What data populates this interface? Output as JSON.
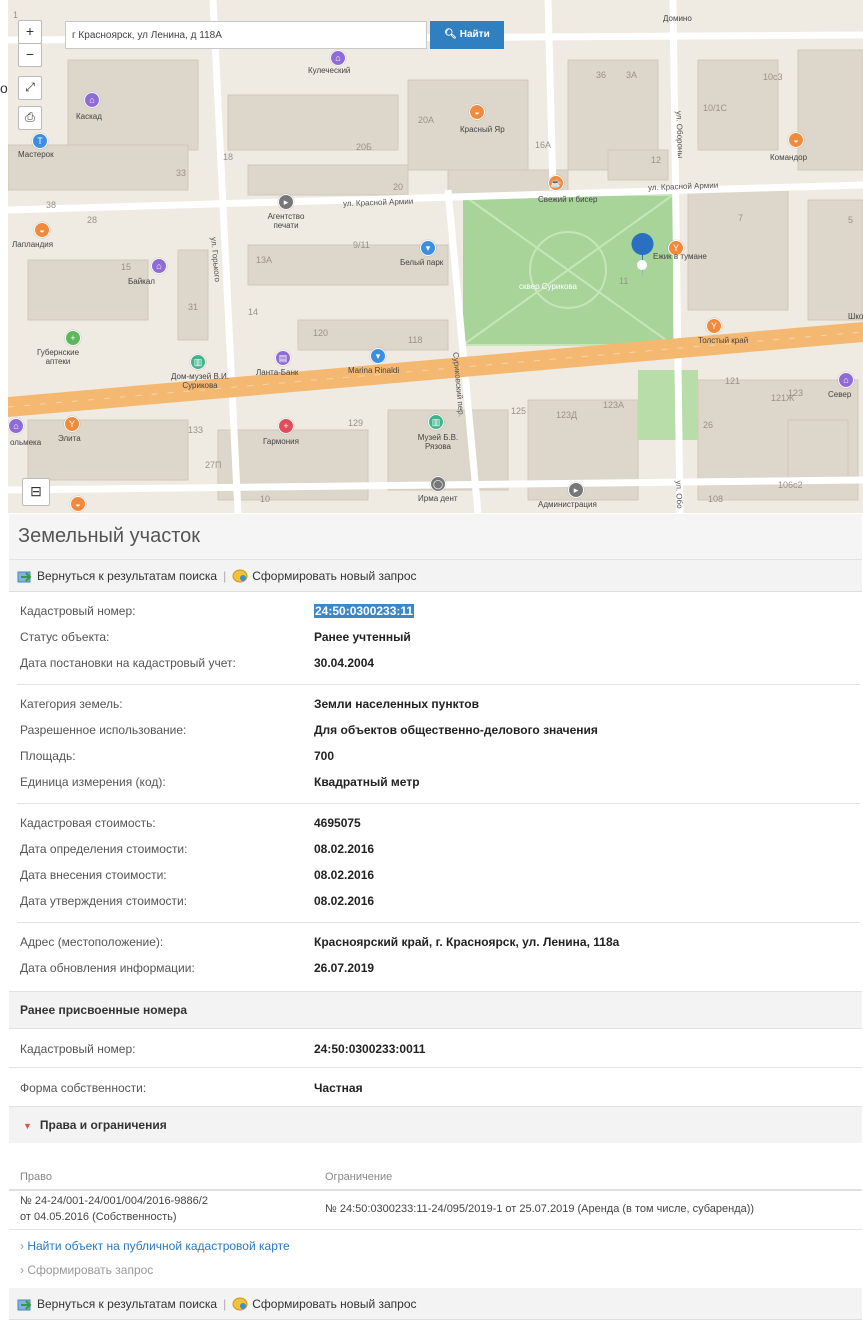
{
  "map": {
    "search_value": "г Красноярск, ул Ленина, д 118А",
    "find_button": "Найти",
    "zoom_in": "+",
    "zoom_out": "−",
    "fullscreen": "⤢",
    "print": "⎙",
    "layers": "⊟",
    "edge_letter": "о",
    "labels": {
      "domino": "Домино",
      "kuptsy": "Кулеческий",
      "kaskad": "Каскад",
      "masterok": "Мастерок",
      "krasny_yar": "Красный Яр",
      "komandor": "Командор",
      "svezhi": "Свежий и бисер",
      "agentstvo": "Агентство печати",
      "laplandia": "Лапландия",
      "baikal": "Байкал",
      "bely_park": "Белый парк",
      "ezhik": "Ежик в тумане",
      "skver": "сквер Сурикова",
      "gubernskie": "Губернские аптеки",
      "dom_muzei": "Дом-музей В.И. Сурикова",
      "lanta": "Ланта-Банк",
      "marina": "Marina Rinaldi",
      "tolsty": "Толстый край",
      "sever": "Север",
      "shkola": "Школа",
      "elita": "Элита",
      "garmonia": "Гармония",
      "muzei_rezova": "Музей Б.В. Рязова",
      "irma": "Ирма дент",
      "admin": "Администрация",
      "shelves": "ольмека"
    },
    "streets": {
      "krasnoy_armii_1": "ул. Красной Армии",
      "krasnoy_armii_2": "ул. Красной Армии",
      "gorkogo": "ул. Горького",
      "surikova": "Суриковский пер.",
      "oborony": "ул. Обороны",
      "oborony2": "ул. Обо"
    },
    "house_numbers": [
      "36",
      "3А",
      "10с3",
      "10/1С",
      "20А",
      "20Б",
      "16А",
      "12",
      "33",
      "18",
      "28",
      "20",
      "7",
      "5",
      "38",
      "9/11",
      "15",
      "13А",
      "31",
      "14",
      "120",
      "118",
      "11",
      "121",
      "123",
      "121Ж",
      "133",
      "129",
      "125",
      "123Д",
      "123А",
      "26",
      "27П",
      "10",
      "108",
      "106с2",
      "1"
    ]
  },
  "panel": {
    "title": "Земельный участок",
    "back_link": "Вернуться к результатам поиска",
    "new_request": "Сформировать новый запрос",
    "separator": "|",
    "rows": [
      {
        "label": "Кадастровый номер:",
        "value": "24:50:0300233:11"
      },
      {
        "label": "Статус объекта:",
        "value": "Ранее учтенный"
      },
      {
        "label": "Дата постановки на кадастровый учет:",
        "value": "30.04.2004"
      },
      {
        "label": "Категория земель:",
        "value": "Земли населенных пунктов"
      },
      {
        "label": "Разрешенное использование:",
        "value": "Для объектов общественно-делового значения"
      },
      {
        "label": "Площадь:",
        "value": "700"
      },
      {
        "label": "Единица измерения (код):",
        "value": "Квадратный метр"
      },
      {
        "label": "Кадастровая стоимость:",
        "value": "4695075"
      },
      {
        "label": "Дата определения стоимости:",
        "value": "08.02.2016"
      },
      {
        "label": "Дата внесения стоимости:",
        "value": "08.02.2016"
      },
      {
        "label": "Дата утверждения стоимости:",
        "value": "08.02.2016"
      },
      {
        "label": "Адрес (местоположение):",
        "value": "Красноярский край, г. Красноярск, ул. Ленина, 118а"
      },
      {
        "label": "Дата обновления информации:",
        "value": "26.07.2019"
      }
    ],
    "prev_numbers_title": "Ранее присвоенные номера",
    "prev_cadastral": {
      "label": "Кадастровый номер:",
      "value": "24:50:0300233:0011"
    },
    "ownership": {
      "label": "Форма собственности:",
      "value": "Частная"
    },
    "rights_title": "Права и ограничения",
    "rights_headers": {
      "right": "Право",
      "restriction": "Ограничение"
    },
    "rights_row": {
      "right_line1": "№ 24-24/001-24/001/004/2016-9886/2",
      "right_line2": "от 04.05.2016  (Собственность)",
      "restriction": "№ 24:50:0300233:11-24/095/2019-1  от 25.07.2019  (Аренда (в том числе, субаренда))"
    },
    "find_on_map": "Найти объект на публичной кадастровой карте",
    "make_request": "Сформировать запрос",
    "link_bullet": "›"
  },
  "colors": {
    "road": "#f5b870",
    "park": "#a8d49a",
    "building": "#ddd6ca",
    "marker": "#2a6fc0",
    "find_button": "#2f7fc1",
    "selection": "#3c87c8",
    "link": "#2a78c0"
  }
}
